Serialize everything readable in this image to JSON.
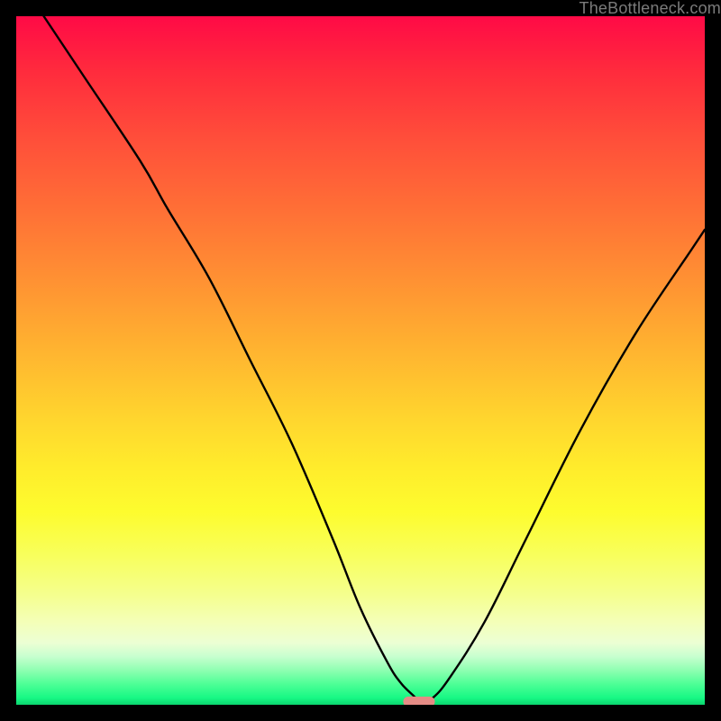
{
  "watermark": "TheBottleneck.com",
  "chart_data": {
    "type": "line",
    "title": "",
    "xlabel": "",
    "ylabel": "",
    "xlim": [
      0,
      100
    ],
    "ylim": [
      0,
      100
    ],
    "grid": false,
    "legend": false,
    "series": [
      {
        "name": "bottleneck-curve",
        "x": [
          4,
          10,
          18,
          22,
          28,
          34,
          40,
          46,
          50,
          54,
          56,
          58,
          58.5,
          60.5,
          63,
          68,
          74,
          82,
          90,
          98,
          100
        ],
        "y": [
          100,
          91,
          79,
          72,
          62,
          50,
          38,
          24,
          14,
          6,
          3,
          1,
          0,
          1,
          4,
          12,
          24,
          40,
          54,
          66,
          69
        ]
      }
    ],
    "baseline_marker": {
      "x": 58.5,
      "y": 0,
      "color": "#e48b85"
    },
    "background_gradient": {
      "stops": [
        {
          "pos": 0.0,
          "color": "#ff0a46"
        },
        {
          "pos": 0.5,
          "color": "#ffd42e"
        },
        {
          "pos": 0.72,
          "color": "#fdfc2e"
        },
        {
          "pos": 0.9,
          "color": "#ecffd4"
        },
        {
          "pos": 1.0,
          "color": "#0bd56f"
        }
      ]
    }
  }
}
